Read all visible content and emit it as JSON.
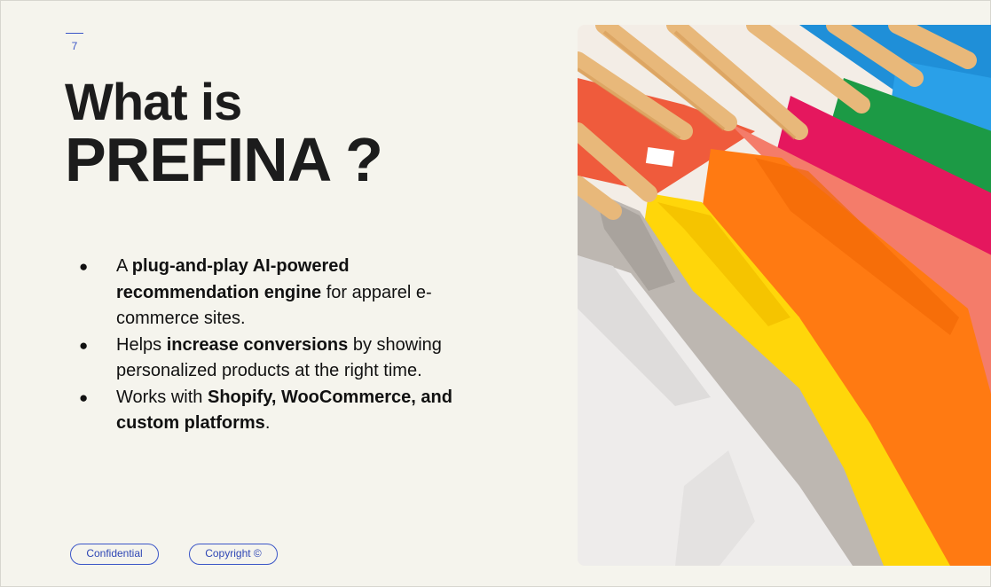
{
  "slide": {
    "page_number": "7",
    "title_line1": "What is",
    "title_line2": "PREFINA ?"
  },
  "bullets": [
    {
      "parts": [
        {
          "text": "A ",
          "bold": false
        },
        {
          "text": "plug-and-play AI-powered recommendation engine",
          "bold": true
        },
        {
          "text": " for apparel e-commerce sites.",
          "bold": false
        }
      ]
    },
    {
      "parts": [
        {
          "text": "Helps ",
          "bold": false
        },
        {
          "text": "increase conversions",
          "bold": true
        },
        {
          "text": " by showing personalized products at the right time.",
          "bold": false
        }
      ]
    },
    {
      "parts": [
        {
          "text": "Works with ",
          "bold": false
        },
        {
          "text": "Shopify, WooCommerce, and custom platforms",
          "bold": true
        },
        {
          "text": ".",
          "bold": false
        }
      ]
    }
  ],
  "bullet_glyph": "●",
  "footer": {
    "confidential_label": "Confidential",
    "copyright_label": "Copyright ©"
  },
  "colors": {
    "background": "#f5f4ed",
    "accent": "#3a55c7",
    "title": "#1c1c1c"
  },
  "image": {
    "subject": "colorful t-shirts hanging on wooden hangers"
  }
}
